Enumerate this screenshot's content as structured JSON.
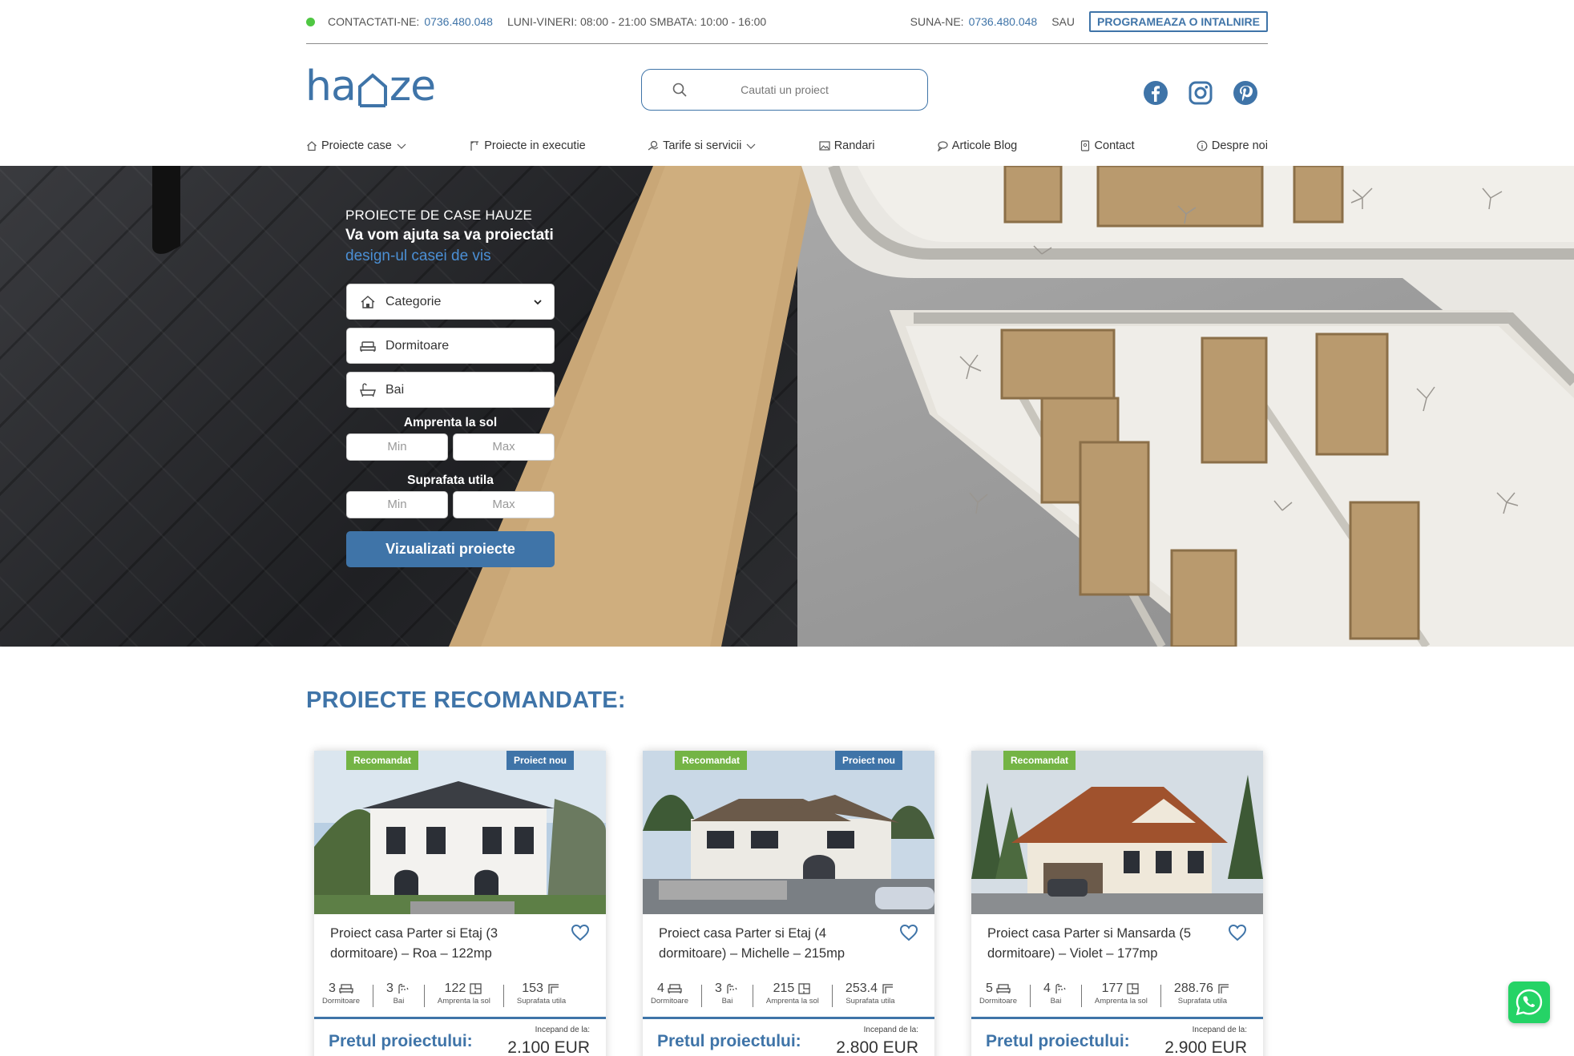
{
  "topbar": {
    "contact_label": "CONTACTATI-NE:",
    "contact_phone": "0736.480.048",
    "hours": "LUNI-VINERI: 08:00 - 21:00 SMBATA: 10:00 - 16:00",
    "call_label": "SUNA-NE:",
    "call_phone": "0736.480.048",
    "or_label": "SAU",
    "appointment_button": "PROGRAMEAZA O INTALNIRE"
  },
  "header": {
    "logo_text_left": "ha",
    "logo_text_right": "ze",
    "search_placeholder": "Cautati un proiect",
    "social_icons": [
      "facebook-icon",
      "instagram-icon",
      "pinterest-icon"
    ]
  },
  "nav": {
    "items": [
      {
        "label": "Proiecte case",
        "icon": "home-icon",
        "dropdown": true
      },
      {
        "label": "Proiecte in executie",
        "icon": "crane-icon",
        "dropdown": false
      },
      {
        "label": "Tarife si servicii",
        "icon": "coins-icon",
        "dropdown": true
      },
      {
        "label": "Randari",
        "icon": "image-icon",
        "dropdown": false
      },
      {
        "label": "Articole Blog",
        "icon": "chat-icon",
        "dropdown": false
      },
      {
        "label": "Contact",
        "icon": "contact-card-icon",
        "dropdown": false
      },
      {
        "label": "Despre noi",
        "icon": "info-icon",
        "dropdown": false
      }
    ]
  },
  "hero": {
    "kicker": "PROIECTE DE CASE HAUZE",
    "title": "Va vom ajuta sa va proiectati",
    "subtitle": "design-ul casei de vis",
    "filters": {
      "category": "Categorie",
      "bedrooms": "Dormitoare",
      "bathrooms": "Bai",
      "footprint_label": "Amprenta la sol",
      "usable_label": "Suprafata utila",
      "min_placeholder": "Min",
      "max_placeholder": "Max",
      "submit": "Vizualizati proiecte"
    }
  },
  "recommended": {
    "heading": "PROIECTE RECOMANDATE:",
    "price_label": "Pretul proiectului:",
    "from_label": "Incepand de la:",
    "unit_labels": {
      "bedrooms": "Dormitoare",
      "baths": "Bai",
      "footprint": "Amprenta la sol",
      "usable": "Suprafata utila"
    },
    "cards": [
      {
        "badge_recommended": "Recomandat",
        "badge_new": "Proiect nou",
        "title": "Proiect casa Parter si Etaj (3 dormitoare) – Roa – 122mp",
        "bedrooms": "3",
        "baths": "3",
        "footprint": "122",
        "usable": "153",
        "price": "2.100 EUR"
      },
      {
        "badge_recommended": "Recomandat",
        "badge_new": "Proiect nou",
        "title": "Proiect casa Parter si Etaj (4 dormitoare) – Michelle – 215mp",
        "bedrooms": "4",
        "baths": "3",
        "footprint": "215",
        "usable": "253.4",
        "price": "2.800 EUR"
      },
      {
        "badge_recommended": "Recomandat",
        "badge_new": "",
        "title": "Proiect casa Parter si Mansarda (5 dormitoare) – Violet – 177mp",
        "bedrooms": "5",
        "baths": "4",
        "footprint": "177",
        "usable": "288.76",
        "price": "2.900 EUR"
      }
    ]
  },
  "colors": {
    "brand_blue": "#3f74a8",
    "accent_green": "#74b445",
    "status_dot": "#4fc742",
    "whatsapp_green": "#25d366"
  }
}
